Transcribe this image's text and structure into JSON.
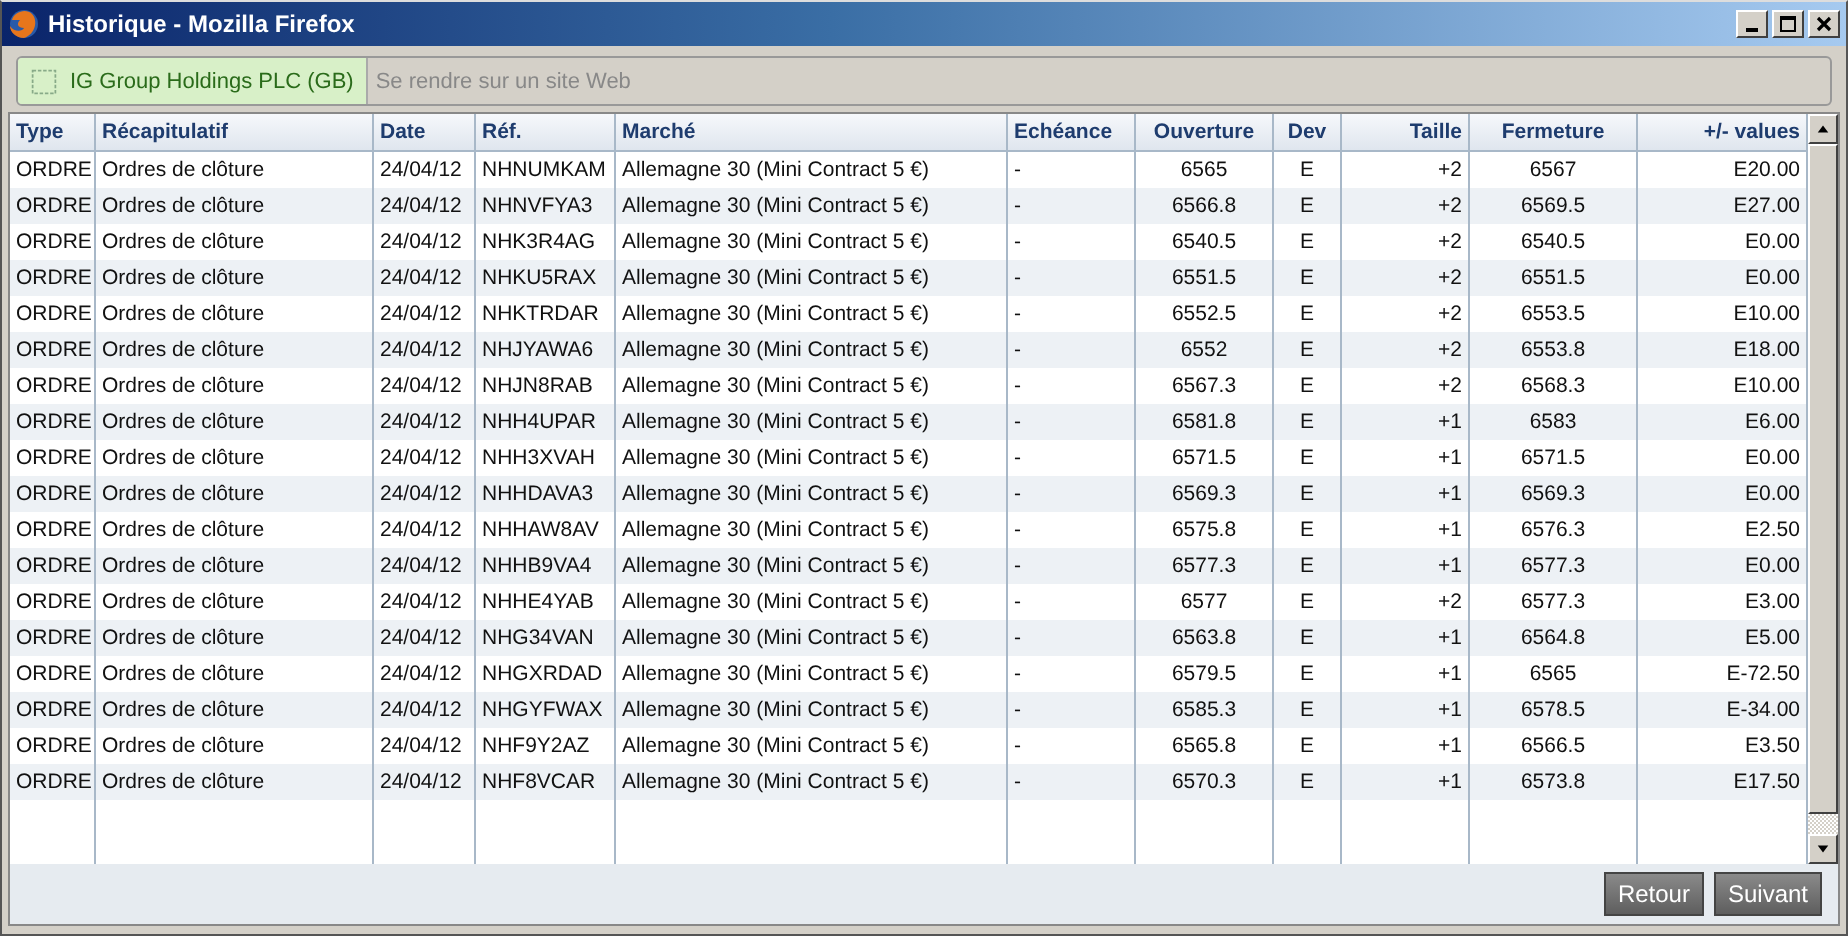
{
  "window": {
    "title": "Historique - Mozilla Firefox"
  },
  "address_bar": {
    "site_identity": "IG Group Holdings PLC (GB)",
    "placeholder": "Se rendre sur un site Web"
  },
  "table": {
    "columns": [
      "Type",
      "Récapitulatif",
      "Date",
      "Réf.",
      "Marché",
      "Echéance",
      "Ouverture",
      "Dev",
      "Taille",
      "Fermeture",
      "+/- values"
    ],
    "rows": [
      [
        "ORDRE",
        "Ordres de clôture",
        "24/04/12",
        "NHNUMKAM",
        "Allemagne 30 (Mini Contract 5 €)",
        "-",
        "6565",
        "E",
        "+2",
        "6567",
        "E20.00"
      ],
      [
        "ORDRE",
        "Ordres de clôture",
        "24/04/12",
        "NHNVFYA3",
        "Allemagne 30 (Mini Contract 5 €)",
        "-",
        "6566.8",
        "E",
        "+2",
        "6569.5",
        "E27.00"
      ],
      [
        "ORDRE",
        "Ordres de clôture",
        "24/04/12",
        "NHK3R4AG",
        "Allemagne 30 (Mini Contract 5 €)",
        "-",
        "6540.5",
        "E",
        "+2",
        "6540.5",
        "E0.00"
      ],
      [
        "ORDRE",
        "Ordres de clôture",
        "24/04/12",
        "NHKU5RAX",
        "Allemagne 30 (Mini Contract 5 €)",
        "-",
        "6551.5",
        "E",
        "+2",
        "6551.5",
        "E0.00"
      ],
      [
        "ORDRE",
        "Ordres de clôture",
        "24/04/12",
        "NHKTRDAR",
        "Allemagne 30 (Mini Contract 5 €)",
        "-",
        "6552.5",
        "E",
        "+2",
        "6553.5",
        "E10.00"
      ],
      [
        "ORDRE",
        "Ordres de clôture",
        "24/04/12",
        "NHJYAWA6",
        "Allemagne 30 (Mini Contract 5 €)",
        "-",
        "6552",
        "E",
        "+2",
        "6553.8",
        "E18.00"
      ],
      [
        "ORDRE",
        "Ordres de clôture",
        "24/04/12",
        "NHJN8RAB",
        "Allemagne 30 (Mini Contract 5 €)",
        "-",
        "6567.3",
        "E",
        "+2",
        "6568.3",
        "E10.00"
      ],
      [
        "ORDRE",
        "Ordres de clôture",
        "24/04/12",
        "NHH4UPAR",
        "Allemagne 30 (Mini Contract 5 €)",
        "-",
        "6581.8",
        "E",
        "+1",
        "6583",
        "E6.00"
      ],
      [
        "ORDRE",
        "Ordres de clôture",
        "24/04/12",
        "NHH3XVAH",
        "Allemagne 30 (Mini Contract 5 €)",
        "-",
        "6571.5",
        "E",
        "+1",
        "6571.5",
        "E0.00"
      ],
      [
        "ORDRE",
        "Ordres de clôture",
        "24/04/12",
        "NHHDAVA3",
        "Allemagne 30 (Mini Contract 5 €)",
        "-",
        "6569.3",
        "E",
        "+1",
        "6569.3",
        "E0.00"
      ],
      [
        "ORDRE",
        "Ordres de clôture",
        "24/04/12",
        "NHHAW8AV",
        "Allemagne 30 (Mini Contract 5 €)",
        "-",
        "6575.8",
        "E",
        "+1",
        "6576.3",
        "E2.50"
      ],
      [
        "ORDRE",
        "Ordres de clôture",
        "24/04/12",
        "NHHB9VA4",
        "Allemagne 30 (Mini Contract 5 €)",
        "-",
        "6577.3",
        "E",
        "+1",
        "6577.3",
        "E0.00"
      ],
      [
        "ORDRE",
        "Ordres de clôture",
        "24/04/12",
        "NHHE4YAB",
        "Allemagne 30 (Mini Contract 5 €)",
        "-",
        "6577",
        "E",
        "+2",
        "6577.3",
        "E3.00"
      ],
      [
        "ORDRE",
        "Ordres de clôture",
        "24/04/12",
        "NHG34VAN",
        "Allemagne 30 (Mini Contract 5 €)",
        "-",
        "6563.8",
        "E",
        "+1",
        "6564.8",
        "E5.00"
      ],
      [
        "ORDRE",
        "Ordres de clôture",
        "24/04/12",
        "NHGXRDAD",
        "Allemagne 30 (Mini Contract 5 €)",
        "-",
        "6579.5",
        "E",
        "+1",
        "6565",
        "E-72.50"
      ],
      [
        "ORDRE",
        "Ordres de clôture",
        "24/04/12",
        "NHGYFWAX",
        "Allemagne 30 (Mini Contract 5 €)",
        "-",
        "6585.3",
        "E",
        "+1",
        "6578.5",
        "E-34.00"
      ],
      [
        "ORDRE",
        "Ordres de clôture",
        "24/04/12",
        "NHF9Y2AZ",
        "Allemagne 30 (Mini Contract 5 €)",
        "-",
        "6565.8",
        "E",
        "+1",
        "6566.5",
        "E3.50"
      ],
      [
        "ORDRE",
        "Ordres de clôture",
        "24/04/12",
        "NHF8VCAR",
        "Allemagne 30 (Mini Contract 5 €)",
        "-",
        "6570.3",
        "E",
        "+1",
        "6573.8",
        "E17.50"
      ]
    ]
  },
  "buttons": [
    "Retour",
    "Suivant"
  ]
}
